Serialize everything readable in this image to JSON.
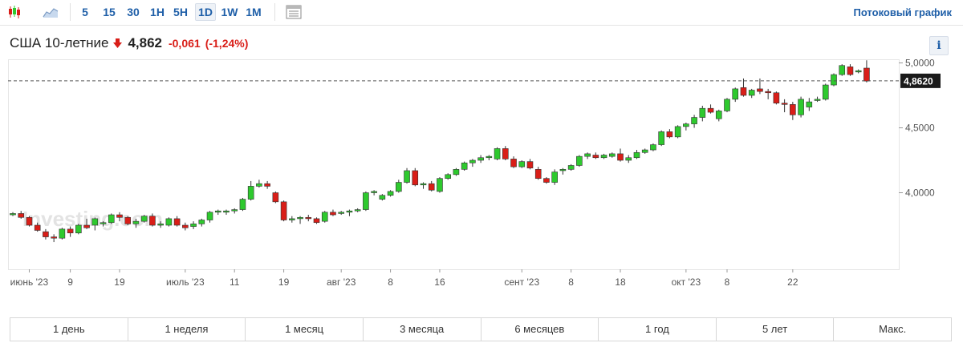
{
  "toolbar": {
    "timeframes": [
      "5",
      "15",
      "30",
      "1H",
      "5H",
      "1D",
      "1W",
      "1M"
    ],
    "active_timeframe": "1D",
    "stream_link": "Потоковый график"
  },
  "quote": {
    "name": "США 10-летние",
    "price": "4,862",
    "change": "-0,061",
    "change_pct": "(-1,24%)",
    "direction": "down",
    "down_color": "#d91e18"
  },
  "info_button": "i",
  "ranges": [
    "1 день",
    "1 неделя",
    "1 месяц",
    "3 месяца",
    "6 месяцев",
    "1 год",
    "5 лет",
    "Макс."
  ],
  "chart_data": {
    "type": "candlestick",
    "watermark": "Investing.com",
    "up_color": "#2ec92e",
    "down_color": "#d91e18",
    "current_value": 4.862,
    "current_label": "4,8620",
    "ylim": [
      3.58,
      5.14
    ],
    "y_ticks": [
      {
        "value": 4.0,
        "label": "4,0000"
      },
      {
        "value": 4.5,
        "label": "4,5000"
      },
      {
        "value": 5.0,
        "label": "5,0000"
      }
    ],
    "x_ticks": [
      {
        "index": 2,
        "label": "июнь '23"
      },
      {
        "index": 7,
        "label": "9"
      },
      {
        "index": 13,
        "label": "19"
      },
      {
        "index": 21,
        "label": "июль '23"
      },
      {
        "index": 27,
        "label": "11"
      },
      {
        "index": 33,
        "label": "19"
      },
      {
        "index": 40,
        "label": "авг '23"
      },
      {
        "index": 46,
        "label": "8"
      },
      {
        "index": 52,
        "label": "16"
      },
      {
        "index": 62,
        "label": "сент '23"
      },
      {
        "index": 68,
        "label": "8"
      },
      {
        "index": 74,
        "label": "18"
      },
      {
        "index": 82,
        "label": "окт '23"
      },
      {
        "index": 87,
        "label": "8"
      },
      {
        "index": 95,
        "label": "22"
      }
    ],
    "ohlc": [
      [
        3.83,
        3.85,
        3.82,
        3.84
      ],
      [
        3.84,
        3.86,
        3.8,
        3.81
      ],
      [
        3.81,
        3.82,
        3.74,
        3.75
      ],
      [
        3.75,
        3.77,
        3.7,
        3.71
      ],
      [
        3.7,
        3.72,
        3.64,
        3.66
      ],
      [
        3.66,
        3.68,
        3.62,
        3.65
      ],
      [
        3.65,
        3.73,
        3.64,
        3.72
      ],
      [
        3.72,
        3.74,
        3.66,
        3.69
      ],
      [
        3.69,
        3.76,
        3.68,
        3.75
      ],
      [
        3.75,
        3.8,
        3.72,
        3.73
      ],
      [
        3.75,
        3.81,
        3.71,
        3.8
      ],
      [
        3.76,
        3.78,
        3.74,
        3.77
      ],
      [
        3.77,
        3.84,
        3.76,
        3.83
      ],
      [
        3.83,
        3.85,
        3.78,
        3.81
      ],
      [
        3.81,
        3.82,
        3.75,
        3.76
      ],
      [
        3.76,
        3.8,
        3.73,
        3.78
      ],
      [
        3.78,
        3.83,
        3.77,
        3.82
      ],
      [
        3.82,
        3.84,
        3.74,
        3.75
      ],
      [
        3.75,
        3.78,
        3.73,
        3.76
      ],
      [
        3.75,
        3.81,
        3.74,
        3.8
      ],
      [
        3.8,
        3.82,
        3.74,
        3.75
      ],
      [
        3.75,
        3.77,
        3.71,
        3.73
      ],
      [
        3.74,
        3.78,
        3.72,
        3.76
      ],
      [
        3.76,
        3.8,
        3.74,
        3.79
      ],
      [
        3.79,
        3.86,
        3.77,
        3.85
      ],
      [
        3.85,
        3.87,
        3.83,
        3.86
      ],
      [
        3.85,
        3.87,
        3.83,
        3.86
      ],
      [
        3.86,
        3.88,
        3.84,
        3.87
      ],
      [
        3.87,
        3.96,
        3.86,
        3.95
      ],
      [
        3.95,
        4.09,
        3.94,
        4.05
      ],
      [
        4.05,
        4.1,
        4.04,
        4.07
      ],
      [
        4.07,
        4.09,
        4.03,
        4.05
      ],
      [
        4.0,
        4.01,
        3.92,
        3.93
      ],
      [
        3.93,
        3.94,
        3.78,
        3.79
      ],
      [
        3.79,
        3.82,
        3.77,
        3.8
      ],
      [
        3.8,
        3.82,
        3.76,
        3.81
      ],
      [
        3.81,
        3.83,
        3.78,
        3.8
      ],
      [
        3.8,
        3.81,
        3.76,
        3.77
      ],
      [
        3.78,
        3.86,
        3.77,
        3.85
      ],
      [
        3.85,
        3.87,
        3.82,
        3.83
      ],
      [
        3.84,
        3.86,
        3.83,
        3.85
      ],
      [
        3.85,
        3.87,
        3.82,
        3.86
      ],
      [
        3.86,
        3.88,
        3.85,
        3.87
      ],
      [
        3.87,
        4.01,
        3.86,
        4.0
      ],
      [
        4.0,
        4.02,
        3.98,
        4.01
      ],
      [
        3.95,
        3.99,
        3.94,
        3.98
      ],
      [
        3.98,
        4.02,
        3.97,
        4.01
      ],
      [
        4.01,
        4.1,
        4.0,
        4.08
      ],
      [
        4.08,
        4.19,
        4.07,
        4.17
      ],
      [
        4.17,
        4.19,
        4.05,
        4.06
      ],
      [
        4.06,
        4.08,
        4.03,
        4.07
      ],
      [
        4.07,
        4.09,
        4.01,
        4.02
      ],
      [
        4.01,
        4.12,
        4.0,
        4.11
      ],
      [
        4.11,
        4.15,
        4.1,
        4.14
      ],
      [
        4.14,
        4.19,
        4.13,
        4.18
      ],
      [
        4.18,
        4.24,
        4.17,
        4.23
      ],
      [
        4.23,
        4.26,
        4.2,
        4.25
      ],
      [
        4.25,
        4.29,
        4.23,
        4.27
      ],
      [
        4.27,
        4.29,
        4.25,
        4.28
      ],
      [
        4.26,
        4.35,
        4.25,
        4.34
      ],
      [
        4.34,
        4.36,
        4.25,
        4.26
      ],
      [
        4.26,
        4.28,
        4.19,
        4.2
      ],
      [
        4.2,
        4.25,
        4.19,
        4.24
      ],
      [
        4.24,
        4.26,
        4.18,
        4.19
      ],
      [
        4.18,
        4.2,
        4.1,
        4.11
      ],
      [
        4.11,
        4.12,
        4.07,
        4.08
      ],
      [
        4.08,
        4.18,
        4.06,
        4.16
      ],
      [
        4.17,
        4.19,
        4.14,
        4.18
      ],
      [
        4.18,
        4.22,
        4.17,
        4.21
      ],
      [
        4.21,
        4.29,
        4.2,
        4.28
      ],
      [
        4.28,
        4.31,
        4.26,
        4.3
      ],
      [
        4.29,
        4.31,
        4.26,
        4.27
      ],
      [
        4.27,
        4.3,
        4.26,
        4.29
      ],
      [
        4.28,
        4.31,
        4.27,
        4.3
      ],
      [
        4.3,
        4.34,
        4.24,
        4.25
      ],
      [
        4.25,
        4.29,
        4.23,
        4.27
      ],
      [
        4.27,
        4.33,
        4.26,
        4.31
      ],
      [
        4.31,
        4.34,
        4.3,
        4.33
      ],
      [
        4.33,
        4.38,
        4.32,
        4.37
      ],
      [
        4.37,
        4.48,
        4.36,
        4.47
      ],
      [
        4.47,
        4.49,
        4.42,
        4.43
      ],
      [
        4.43,
        4.52,
        4.42,
        4.51
      ],
      [
        4.51,
        4.54,
        4.48,
        4.53
      ],
      [
        4.53,
        4.6,
        4.5,
        4.58
      ],
      [
        4.58,
        4.67,
        4.55,
        4.65
      ],
      [
        4.65,
        4.68,
        4.61,
        4.62
      ],
      [
        4.57,
        4.64,
        4.55,
        4.63
      ],
      [
        4.63,
        4.73,
        4.62,
        4.72
      ],
      [
        4.72,
        4.81,
        4.7,
        4.8
      ],
      [
        4.81,
        4.88,
        4.74,
        4.75
      ],
      [
        4.75,
        4.8,
        4.73,
        4.79
      ],
      [
        4.8,
        4.88,
        4.76,
        4.78
      ],
      [
        4.78,
        4.8,
        4.72,
        4.77
      ],
      [
        4.77,
        4.78,
        4.68,
        4.69
      ],
      [
        4.69,
        4.72,
        4.62,
        4.68
      ],
      [
        4.68,
        4.7,
        4.56,
        4.6
      ],
      [
        4.6,
        4.74,
        4.58,
        4.72
      ],
      [
        4.66,
        4.73,
        4.63,
        4.7
      ],
      [
        4.71,
        4.74,
        4.7,
        4.72
      ],
      [
        4.72,
        4.84,
        4.71,
        4.83
      ],
      [
        4.83,
        4.92,
        4.82,
        4.91
      ],
      [
        4.91,
        4.99,
        4.9,
        4.98
      ],
      [
        4.97,
        4.99,
        4.9,
        4.91
      ],
      [
        4.93,
        4.95,
        4.92,
        4.94
      ],
      [
        4.96,
        5.02,
        4.85,
        4.86
      ]
    ]
  }
}
